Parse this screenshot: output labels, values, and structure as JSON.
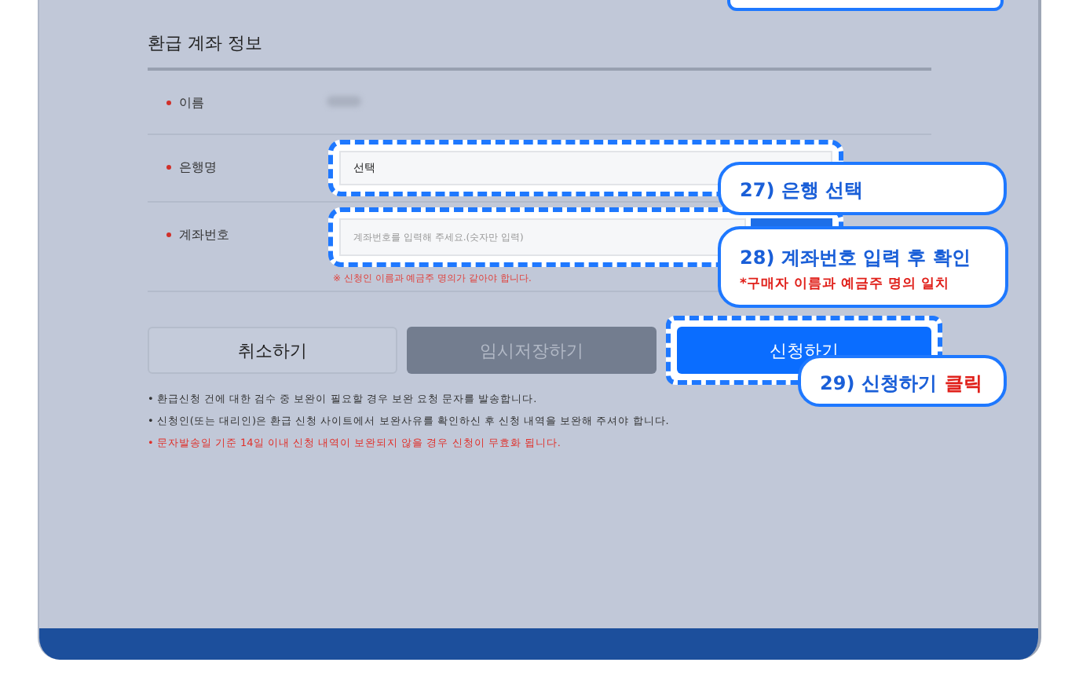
{
  "section_title": "환급 계좌 정보",
  "rows": [
    {
      "kind": "text",
      "label": "이름"
    },
    {
      "kind": "select",
      "label": "은행명",
      "value": "선택",
      "highlighted": true
    },
    {
      "kind": "input",
      "label": "계좌번호",
      "placeholder": "계좌번호를 입력해 주세요.(숫자만 입력)",
      "hint": "※ 신청인 이름과 예금주 명의가 같아야 합니다.",
      "highlighted": true
    }
  ],
  "buttons": [
    {
      "label": "취소하기",
      "kind": "secondary",
      "highlighted": false
    },
    {
      "label": "임시저장하기",
      "kind": "disabled",
      "highlighted": false
    },
    {
      "label": "신청하기",
      "kind": "primary",
      "highlighted": true
    }
  ],
  "notes": [
    {
      "text": "• 환급신청 건에 대한 검수 중 보완이 필요할 경우 보완 요청 문자를 발송합니다.",
      "kind": "normal"
    },
    {
      "text": "• 신청인(또는 대리인)은 환급 신청 사이트에서 보완사유를 확인하신 후 신청 내역을 보완해 주셔야 합니다.",
      "kind": "normal"
    },
    {
      "text": "• 문자발송일 기준 14일 이내 신청 내역이 보완되지 않을 경우 신청이 무효화 됩니다.",
      "kind": "warning"
    }
  ],
  "callouts": [
    {
      "title": "27) 은행 선택"
    },
    {
      "title": "28) 계좌번호 입력 후 확인",
      "note": "*구매자 이름과 예금주 명의 일치"
    },
    {
      "title": "29) 신청하기",
      "emphasis": "클릭"
    }
  ]
}
